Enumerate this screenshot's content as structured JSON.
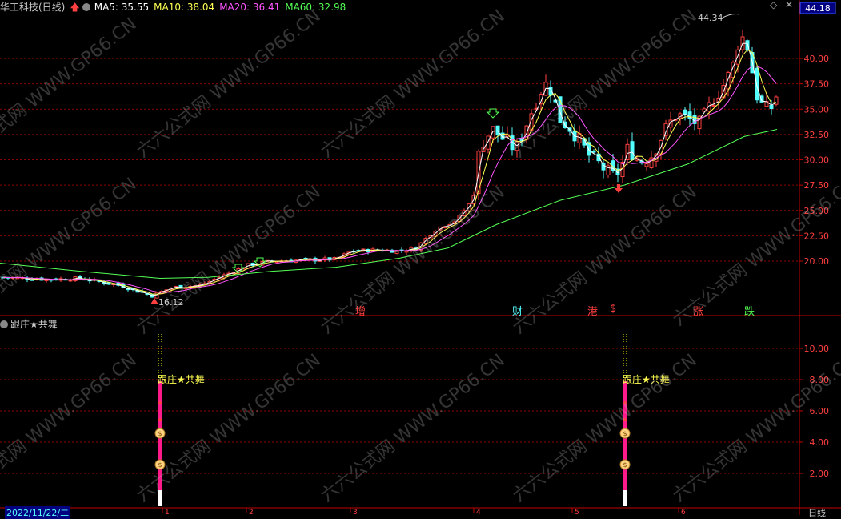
{
  "header": {
    "stock": "华工科技(日线)",
    "ma5": "MA5: 35.55",
    "ma10": "MA10: 38.04",
    "ma20": "MA20: 36.41",
    "ma60": "MA60: 32.98"
  },
  "colors": {
    "up": "#ff4040",
    "down": "#54ffff",
    "ma5": "#ffffff",
    "ma10": "#ffff54",
    "ma20": "#ff54ff",
    "ma60": "#54ff54",
    "grid": "#8b0000",
    "axis": "#c00000"
  },
  "price_panel": {
    "current_price_badge": "44.18",
    "high_label": "44.34",
    "low_label": "16.12",
    "y_axis_labels": [
      "40.00",
      "37.50",
      "35.00",
      "32.50",
      "30.00",
      "27.50",
      "25.00",
      "22.50",
      "20.00"
    ],
    "event_marks": [
      {
        "text": "增",
        "color": "#ff4040"
      },
      {
        "text": "财",
        "color": "#54ffff"
      },
      {
        "text": "港",
        "color": "#ff4040"
      },
      {
        "text": "$",
        "color": "#ff4040"
      },
      {
        "text": "涨",
        "color": "#ff4040"
      },
      {
        "text": "跌",
        "color": "#54ff54"
      }
    ]
  },
  "indicator_panel": {
    "title": "跟庄★共舞",
    "signal_label": "跟庄★共舞",
    "y_axis_labels": [
      "10.00",
      "8.00",
      "6.00",
      "4.00",
      "2.00"
    ]
  },
  "bottom_bar": {
    "date": "2022/11/22/二",
    "period": "日线",
    "months": [
      "1",
      "2",
      "3",
      "4",
      "5",
      "6"
    ]
  },
  "watermark": "六六公式网 WWW.GP66.CN"
}
